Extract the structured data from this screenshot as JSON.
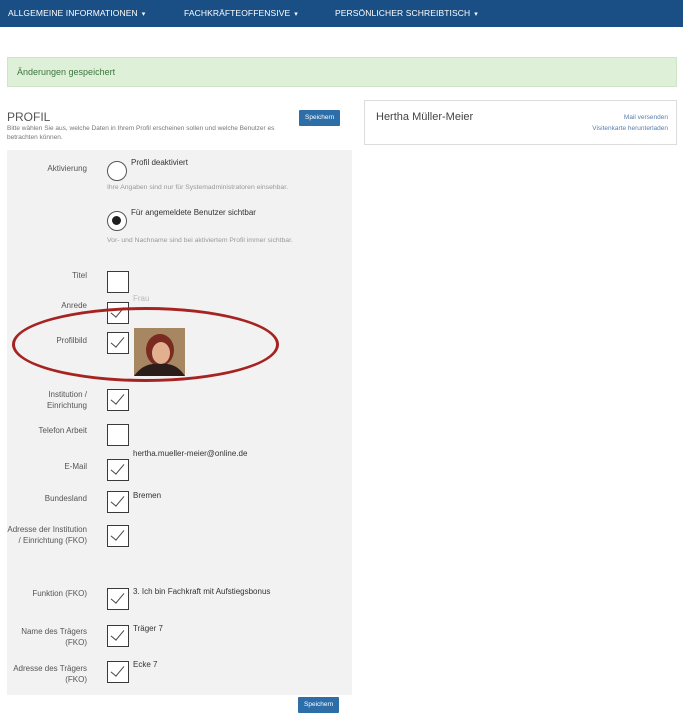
{
  "nav": {
    "items": [
      {
        "label": "ALLGEMEINE INFORMATIONEN"
      },
      {
        "label": "FACHKRÄFTEOFFENSIVE"
      },
      {
        "label": "PERSÖNLICHER SCHREIBTISCH"
      }
    ],
    "caret": "▾"
  },
  "alert": {
    "text": "Änderungen gespeichert"
  },
  "profile": {
    "title": "PROFIL",
    "description": "Bitte wählen Sie aus, welche Daten in Ihrem Profil erscheinen sollen und welche Benutzer es betrachten können.",
    "save_label": "Speichern",
    "activation": {
      "label": "Aktivierung",
      "options": [
        {
          "label": "Profil deaktiviert",
          "help": "Ihre Angaben sind nur für Systemadministratoren einsehbar.",
          "checked": false
        },
        {
          "label": "Für angemeldete Benutzer sichtbar",
          "help": "Vor- und Nachname sind bei aktiviertem Profil immer sichtbar.",
          "checked": true
        }
      ]
    },
    "fields": {
      "titel": {
        "label": "Titel",
        "checked": false,
        "value": ""
      },
      "anrede": {
        "label": "Anrede",
        "checked": true,
        "value": "Frau"
      },
      "profilbild": {
        "label": "Profilbild",
        "checked": true
      },
      "institution": {
        "label": "Institution / Einrichtung",
        "checked": true,
        "value": ""
      },
      "telefon": {
        "label": "Telefon Arbeit",
        "checked": false,
        "value": ""
      },
      "email": {
        "label": "E-Mail",
        "checked": true,
        "value": "hertha.mueller-meier@online.de"
      },
      "bundesland": {
        "label": "Bundesland",
        "checked": true,
        "value": "Bremen"
      },
      "adresse": {
        "label": "Adresse der Institution / Einrichtung (FKO)",
        "checked": true,
        "value": ""
      },
      "funktion": {
        "label": "Funktion (FKO)",
        "checked": true,
        "value": "3. Ich bin Fachkraft mit Aufstiegsbonus"
      },
      "traeger_name": {
        "label": "Name des Trägers (FKO)",
        "checked": true,
        "value": "Träger 7"
      },
      "traeger_adresse": {
        "label": "Adresse des Trägers (FKO)",
        "checked": true,
        "value": "Ecke 7"
      }
    }
  },
  "card": {
    "name": "Hertha Müller-Meier",
    "mail_link": "Mail versenden",
    "vcard_link": "Visitenkarte herunterladen"
  },
  "colors": {
    "nav_bg": "#1a4f86",
    "alert_bg": "#dff0d8",
    "button_bg": "#2d6ea8",
    "annotation_ellipse": "#a52422"
  }
}
